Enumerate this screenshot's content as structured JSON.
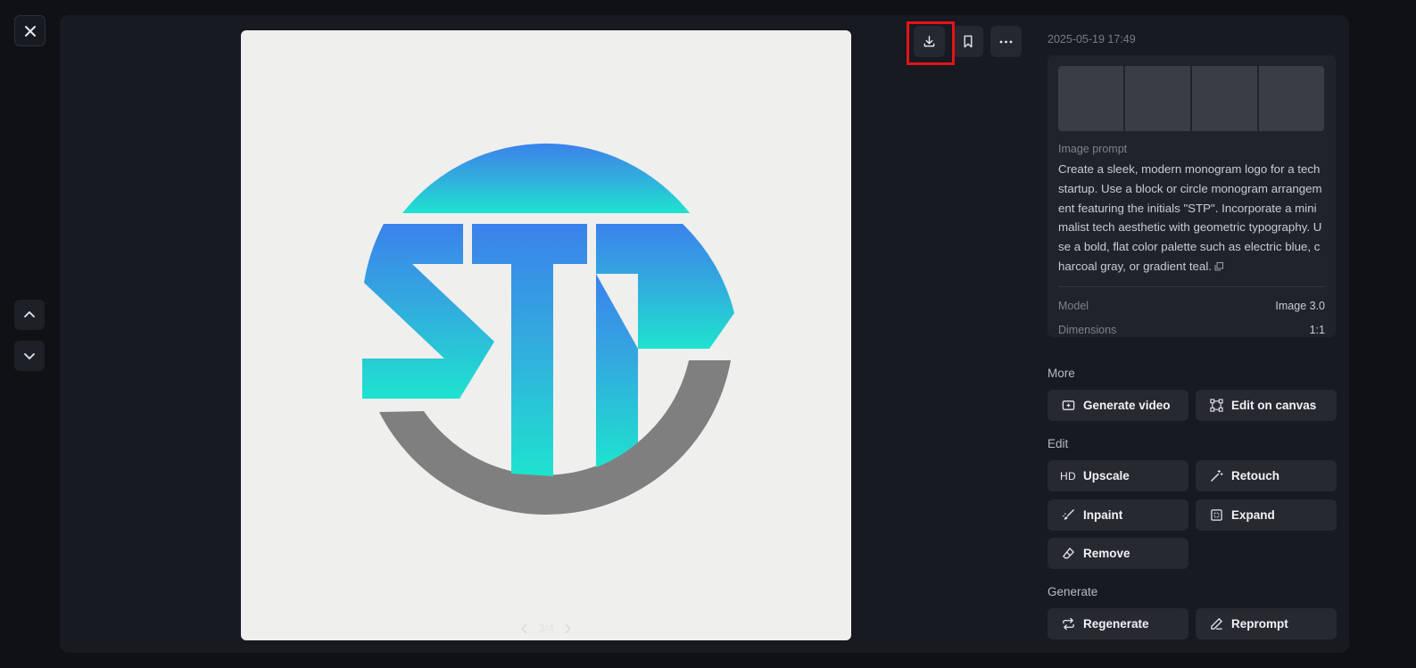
{
  "toolbar": {
    "close": "close-icon",
    "prev": "chevron-up-icon",
    "next": "chevron-down-icon",
    "download": "download-icon",
    "bookmark": "bookmark-icon",
    "more": "more-icon"
  },
  "image": {
    "logo_text": "STP",
    "pager": "3/4",
    "colors": {
      "gradient_top": "#3b82ec",
      "gradient_bottom": "#1ee3cf",
      "ring_gray": "#7f7f7f",
      "background": "#efefee"
    }
  },
  "details": {
    "timestamp": "2025-05-19 17:49",
    "prompt_label": "Image prompt",
    "prompt_text": "Create a sleek, modern monogram logo for a tech startup. Use a block or circle monogram arrangement featuring the initials \"STP\". Incorporate a minimalist tech aesthetic with geometric typography. Use a bold, flat color palette such as electric blue, charcoal gray, or gradient teal.",
    "meta": [
      {
        "key": "Model",
        "value": "Image 3.0"
      },
      {
        "key": "Dimensions",
        "value": "1:1"
      }
    ]
  },
  "sections": {
    "more": {
      "title": "More",
      "buttons": [
        {
          "label": "Generate video",
          "icon": "video-plus-icon"
        },
        {
          "label": "Edit on canvas",
          "icon": "canvas-icon"
        }
      ]
    },
    "edit": {
      "title": "Edit",
      "buttons": [
        {
          "label": "Upscale",
          "icon": "HD"
        },
        {
          "label": "Retouch",
          "icon": "magic-wand-icon"
        },
        {
          "label": "Inpaint",
          "icon": "brush-icon"
        },
        {
          "label": "Expand",
          "icon": "expand-icon"
        },
        {
          "label": "Remove",
          "icon": "eraser-icon"
        }
      ]
    },
    "generate": {
      "title": "Generate",
      "buttons": [
        {
          "label": "Regenerate",
          "icon": "repeat-icon"
        },
        {
          "label": "Reprompt",
          "icon": "pen-icon"
        }
      ]
    }
  },
  "accent": {
    "highlight_border": "#e3131b"
  }
}
